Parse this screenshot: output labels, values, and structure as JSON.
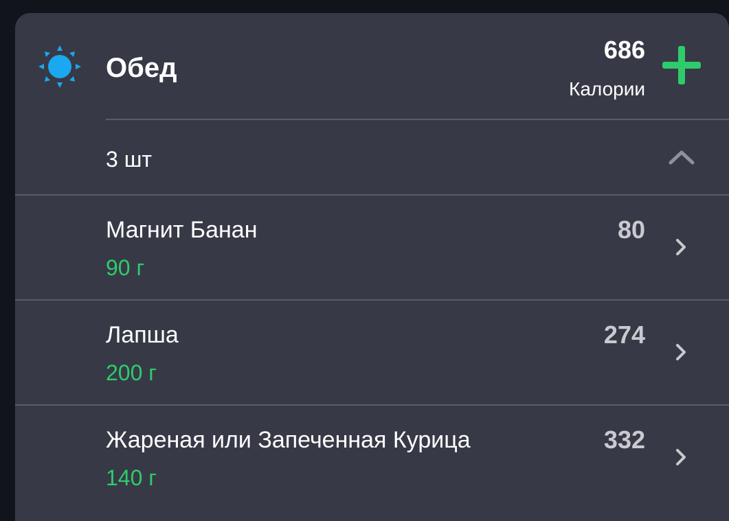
{
  "meal": {
    "title": "Обед",
    "icon": "sun-icon",
    "total_calories": "686",
    "calories_label": "Калории",
    "add_icon": "plus-icon",
    "count_label": "3 шт",
    "collapse_icon": "chevron-up-icon"
  },
  "colors": {
    "card_bg": "#373a46",
    "page_bg": "#12141b",
    "accent_green": "#2ecc6a",
    "sun_blue": "#1aa8f0"
  },
  "items": [
    {
      "name": "Магнит Банан",
      "weight": "90 г",
      "calories": "80"
    },
    {
      "name": "Лапша",
      "weight": "200 г",
      "calories": "274"
    },
    {
      "name": "Жареная или Запеченная Курица",
      "weight": "140 г",
      "calories": "332"
    }
  ]
}
